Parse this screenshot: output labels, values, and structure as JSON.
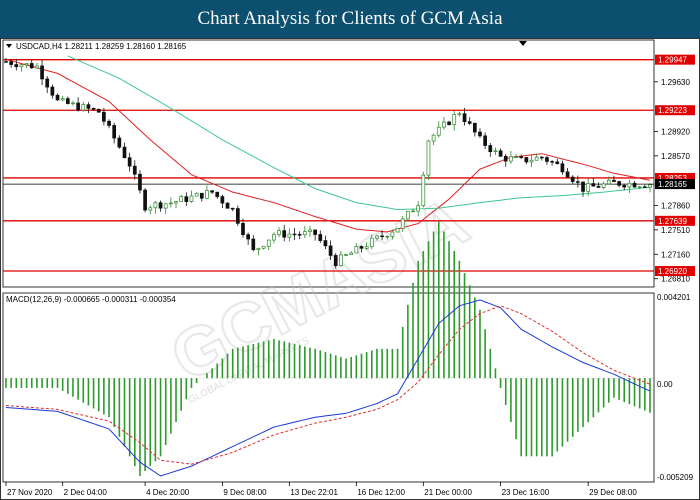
{
  "banner": {
    "title": "Chart Analysis for Clients of GCM Asia"
  },
  "watermark": {
    "text": "GCMASIA",
    "sub": "GLOBAL CAPITAL MARKETS"
  },
  "colors": {
    "banner": "#0d4f6e",
    "bull": "#2a8a2a",
    "bear": "#111111",
    "ma_fast": "#e02020",
    "ma_slow": "#40c890",
    "level": "#e00000",
    "macd_main": "#1a3ad8",
    "macd_signal": "#e03030",
    "macd_hist": "#2e9a2e",
    "label_red": "#e00000",
    "label_black": "#000000"
  },
  "chart_data": [
    {
      "type": "line",
      "title": "USDCAD,H4",
      "header_text": "USDCAD,H4  1.28211 1.28259 1.28160 1.28165",
      "ylim": [
        1.2672,
        1.302
      ],
      "y_ticks": [
        "1.29630",
        "1.28920",
        "1.28570",
        "1.27860",
        "1.27510",
        "1.27160",
        "1.26810"
      ],
      "y_tick_values": [
        1.2963,
        1.2892,
        1.2857,
        1.2786,
        1.2751,
        1.2716,
        1.2681
      ],
      "x_labels": [
        "27 Nov 2020",
        "2 Dec 04:00",
        "4 Dec 20:00",
        "9 Dec 08:00",
        "13 Dec 22:01",
        "16 Dec 12:00",
        "21 Dec 00:00",
        "23 Dec 16:00",
        "29 Dec 08:00"
      ],
      "x_label_bar_index": [
        0,
        11,
        27,
        42,
        55,
        68,
        81,
        96,
        113
      ],
      "current_price": {
        "value": 1.28165,
        "label": "1.28165"
      },
      "levels": [
        {
          "value": 1.29947,
          "label": "1.29947"
        },
        {
          "value": 1.29223,
          "label": "1.29223"
        },
        {
          "value": 1.28253,
          "label": "1.28253"
        },
        {
          "value": 1.27639,
          "label": "1.27639"
        },
        {
          "value": 1.2692,
          "label": "1.26920"
        }
      ],
      "series": [
        {
          "kind": "candles",
          "count": 126,
          "anchors": [
            [
              0,
              1.2992
            ],
            [
              6,
              1.2985
            ],
            [
              10,
              1.2935
            ],
            [
              18,
              1.292
            ],
            [
              24,
              1.2845
            ],
            [
              27,
              1.2785
            ],
            [
              32,
              1.279
            ],
            [
              40,
              1.2805
            ],
            [
              44,
              1.278
            ],
            [
              48,
              1.272
            ],
            [
              52,
              1.2745
            ],
            [
              60,
              1.2745
            ],
            [
              64,
              1.2705
            ],
            [
              70,
              1.273
            ],
            [
              76,
              1.2755
            ],
            [
              80,
              1.279
            ],
            [
              82,
              1.288
            ],
            [
              85,
              1.29
            ],
            [
              88,
              1.292
            ],
            [
              92,
              1.288
            ],
            [
              96,
              1.2855
            ],
            [
              100,
              1.285
            ],
            [
              104,
              1.2855
            ],
            [
              108,
              1.284
            ],
            [
              112,
              1.281
            ],
            [
              118,
              1.2818
            ],
            [
              125,
              1.28165
            ]
          ]
        },
        {
          "kind": "moving_average_fast",
          "anchors": [
            [
              0,
              1.2995
            ],
            [
              10,
              1.2975
            ],
            [
              20,
              1.2935
            ],
            [
              28,
              1.288
            ],
            [
              36,
              1.283
            ],
            [
              44,
              1.2805
            ],
            [
              52,
              1.279
            ],
            [
              60,
              1.277
            ],
            [
              68,
              1.2752
            ],
            [
              74,
              1.2748
            ],
            [
              80,
              1.276
            ],
            [
              86,
              1.2795
            ],
            [
              92,
              1.2838
            ],
            [
              98,
              1.2855
            ],
            [
              104,
              1.286
            ],
            [
              112,
              1.2845
            ],
            [
              118,
              1.2832
            ],
            [
              125,
              1.2822
            ]
          ]
        },
        {
          "kind": "moving_average_slow",
          "anchors": [
            [
              12,
              1.3
            ],
            [
              22,
              1.2968
            ],
            [
              32,
              1.2925
            ],
            [
              42,
              1.288
            ],
            [
              52,
              1.284
            ],
            [
              60,
              1.281
            ],
            [
              68,
              1.279
            ],
            [
              76,
              1.278
            ],
            [
              84,
              1.2782
            ],
            [
              92,
              1.279
            ],
            [
              100,
              1.2797
            ],
            [
              108,
              1.28
            ],
            [
              116,
              1.2805
            ],
            [
              125,
              1.2812
            ]
          ]
        }
      ]
    },
    {
      "type": "bar",
      "title": "MACD(12,26,9) -0.000665 -0.000311 -0.000354",
      "ylim": [
        -0.005209,
        0.004201
      ],
      "y_ticks": [
        "0.004201",
        "0.00",
        "-0.005209"
      ],
      "y_tick_values": [
        0.004201,
        0.0,
        -0.005209
      ],
      "series": [
        {
          "name": "main",
          "kind": "line",
          "anchors": [
            [
              0,
              -0.0015
            ],
            [
              10,
              -0.0017
            ],
            [
              20,
              -0.0026
            ],
            [
              26,
              -0.0043
            ],
            [
              30,
              -0.005
            ],
            [
              36,
              -0.0045
            ],
            [
              44,
              -0.0035
            ],
            [
              52,
              -0.0025
            ],
            [
              60,
              -0.002
            ],
            [
              66,
              -0.0018
            ],
            [
              72,
              -0.0013
            ],
            [
              76,
              -0.0008
            ],
            [
              80,
              0.001
            ],
            [
              84,
              0.0028
            ],
            [
              88,
              0.0037
            ],
            [
              92,
              0.004
            ],
            [
              96,
              0.0036
            ],
            [
              100,
              0.0025
            ],
            [
              106,
              0.0016
            ],
            [
              112,
              0.0008
            ],
            [
              118,
              0.0002
            ],
            [
              125,
              -0.000665
            ]
          ]
        },
        {
          "name": "signal",
          "kind": "dashed",
          "anchors": [
            [
              0,
              -0.0014
            ],
            [
              10,
              -0.0016
            ],
            [
              20,
              -0.0022
            ],
            [
              26,
              -0.0033
            ],
            [
              30,
              -0.0042
            ],
            [
              36,
              -0.0044
            ],
            [
              44,
              -0.0038
            ],
            [
              52,
              -0.0029
            ],
            [
              60,
              -0.0023
            ],
            [
              66,
              -0.002
            ],
            [
              72,
              -0.0016
            ],
            [
              76,
              -0.0011
            ],
            [
              80,
              -0.0002
            ],
            [
              84,
              0.0012
            ],
            [
              88,
              0.0025
            ],
            [
              92,
              0.0033
            ],
            [
              96,
              0.0037
            ],
            [
              100,
              0.0033
            ],
            [
              106,
              0.0024
            ],
            [
              112,
              0.0013
            ],
            [
              118,
              0.0004
            ],
            [
              125,
              -0.000311
            ]
          ]
        }
      ]
    }
  ]
}
